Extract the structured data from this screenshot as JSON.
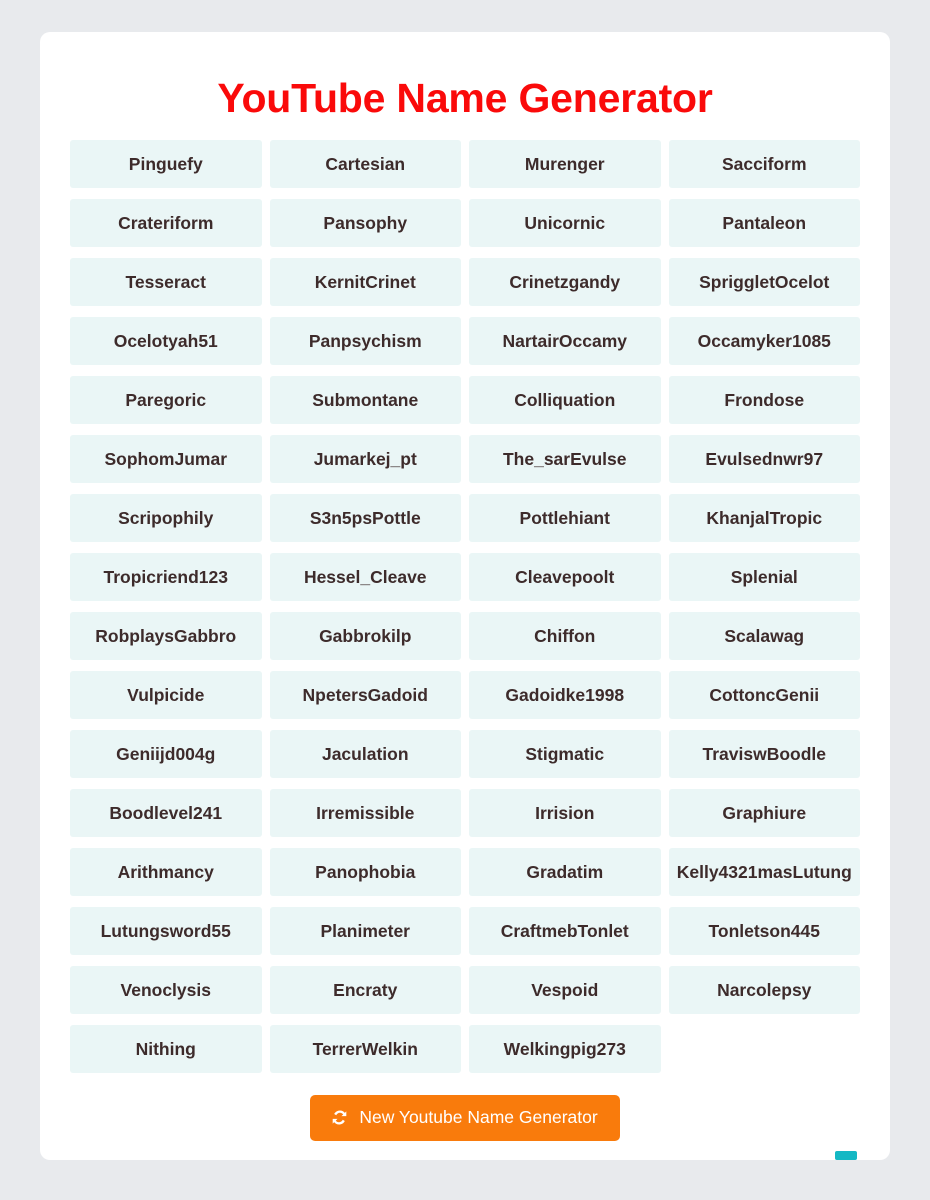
{
  "page": {
    "background_color": "#e8eaed",
    "card_background_color": "#ffffff"
  },
  "header": {
    "title": "YouTube Name Generator",
    "title_color": "#fa0a0a"
  },
  "grid": {
    "columns": 4,
    "tile_background_color": "#eaf6f6",
    "tile_text_color": "#3d2b2b",
    "count": 63,
    "names": [
      "Pinguefy",
      "Cartesian",
      "Murenger",
      "Sacciform",
      "Crateriform",
      "Pansophy",
      "Unicornic",
      "Pantaleon",
      "Tesseract",
      "KernitCrinet",
      "Crinetzgandy",
      "SpriggletOcelot",
      "Ocelotyah51",
      "Panpsychism",
      "NartairOccamy",
      "Occamyker1085",
      "Paregoric",
      "Submontane",
      "Colliquation",
      "Frondose",
      "SophomJumar",
      "Jumarkej_pt",
      "The_sarEvulse",
      "Evulsednwr97",
      "Scripophily",
      "S3n5psPottle",
      "Pottlehiant",
      "KhanjalTropic",
      "Tropicriend123",
      "Hessel_Cleave",
      "Cleavepoolt",
      "Splenial",
      "RobplaysGabbro",
      "Gabbrokilp",
      "Chiffon",
      "Scalawag",
      "Vulpicide",
      "NpetersGadoid",
      "Gadoidke1998",
      "CottoncGenii",
      "Geniijd004g",
      "Jaculation",
      "Stigmatic",
      "TraviswBoodle",
      "Boodlevel241",
      "Irremissible",
      "Irrision",
      "Graphiure",
      "Arithmancy",
      "Panophobia",
      "Gradatim",
      "Kelly4321masLutung",
      "Lutungsword55",
      "Planimeter",
      "CraftmebTonlet",
      "Tonletson445",
      "Venoclysis",
      "Encraty",
      "Vespoid",
      "Narcolepsy",
      "Nithing",
      "TerrerWelkin",
      "Welkingpig273"
    ]
  },
  "actions": {
    "generate_label": "New Youtube Name Generator",
    "generate_icon": "sync-icon",
    "generate_background_color": "#f97b0c",
    "generate_text_color": "#ffffff"
  },
  "artifacts": {
    "corner_marker_color": "#14b8c4"
  }
}
